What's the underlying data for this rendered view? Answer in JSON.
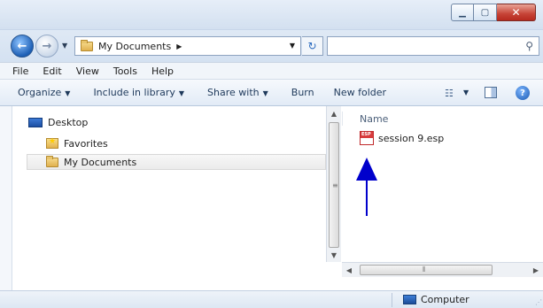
{
  "address": {
    "location": "My Documents",
    "search_placeholder": ""
  },
  "menu": [
    "File",
    "Edit",
    "View",
    "Tools",
    "Help"
  ],
  "commands": {
    "organize": "Organize",
    "include_in_library": "Include in library",
    "share_with": "Share with",
    "burn": "Burn",
    "new_folder": "New folder"
  },
  "nav_tree": [
    {
      "label": "Desktop"
    },
    {
      "label": "Favorites"
    },
    {
      "label": "My Documents",
      "selected": true
    }
  ],
  "content": {
    "column_name": "Name",
    "files": [
      {
        "name": "session 9.esp",
        "icon_text": "ESP"
      }
    ]
  },
  "status": {
    "location": "Computer"
  },
  "colors": {
    "accent": "#1f5fb8",
    "arrow": "#0000cc"
  }
}
